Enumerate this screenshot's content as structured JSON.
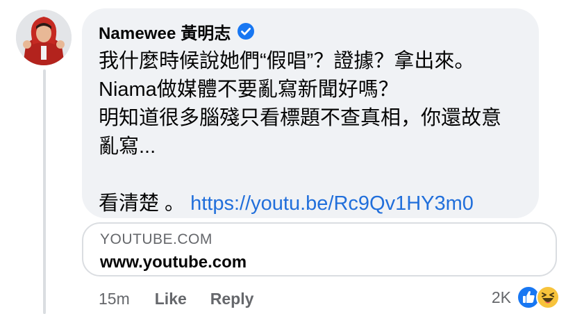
{
  "comment": {
    "author": "Namewee 黃明志",
    "verified_icon": "verified-badge-icon",
    "lines": [
      "我什麼時候說她們“假唱”？證據？拿出來。",
      "Niama做媒體不要亂寫新聞好嗎？",
      "明知道很多腦殘只看標題不查真相，你還故意",
      "亂寫..."
    ],
    "last_line_text": "看清楚 。",
    "link_text": "https://youtu.be/Rc9Qv1HY3m0"
  },
  "link_preview": {
    "domain": "YOUTUBE.COM",
    "title": "www.youtube.com"
  },
  "actions": {
    "timestamp": "15m",
    "like_label": "Like",
    "reply_label": "Reply"
  },
  "reactions": {
    "count": "2K",
    "icons": [
      "like-reaction-icon",
      "haha-reaction-icon"
    ]
  },
  "colors": {
    "bubble": "#f0f2f5",
    "link": "#216fdb",
    "secondary_text": "#65676b",
    "verified": "#1877f2"
  }
}
